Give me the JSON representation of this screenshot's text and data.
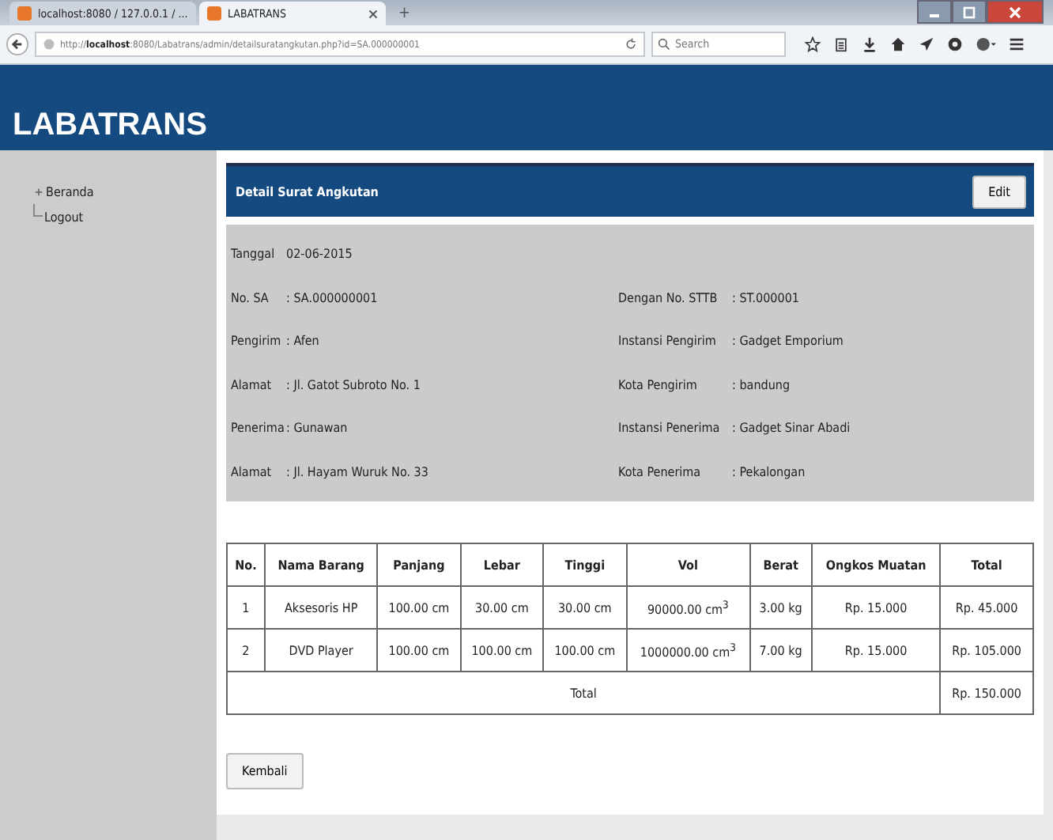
{
  "browser": {
    "tabs": [
      {
        "title": "localhost:8080 / 127.0.0.1 / ...",
        "selected": false
      },
      {
        "title": "LABATRANS",
        "selected": true
      }
    ],
    "new_tab": "+",
    "url_prefix": "http://",
    "url_host": "localhost",
    "url_rest": ":8080/Labatrans/admin/detailsuratangkutan.php?id=SA.000000001",
    "search": {
      "placeholder": "Search"
    }
  },
  "header": {
    "title": "LABATRANS"
  },
  "sidebar": {
    "items": [
      {
        "label": "Beranda",
        "expanded": false
      },
      {
        "label": "Logout"
      }
    ]
  },
  "panel": {
    "title": "Detail Surat Angkutan",
    "edit_button": "Edit"
  },
  "date": {
    "label": "Tanggal",
    "value": "02-06-2015"
  },
  "details": [
    {
      "left": {
        "label": "No. SA",
        "value": ": SA.000000001"
      },
      "right": {
        "label": "Dengan No. STTB",
        "value": ": ST.000001"
      }
    },
    {
      "left": {
        "label": "Pengirim",
        "value": ": Afen"
      },
      "right": {
        "label": "Instansi Pengirim",
        "value": ": Gadget Emporium"
      }
    },
    {
      "left": {
        "label": "Alamat",
        "value": ": Jl. Gatot Subroto No. 1"
      },
      "right": {
        "label": "Kota Pengirim",
        "value": ": bandung"
      }
    },
    {
      "left": {
        "label": "Penerima",
        "value": ": Gunawan"
      },
      "right": {
        "label": "Instansi Penerima",
        "value": ": Gadget Sinar Abadi"
      }
    },
    {
      "left": {
        "label": "Alamat",
        "value": ": Jl. Hayam Wuruk No. 33"
      },
      "right": {
        "label": "Kota Penerima",
        "value": ": Pekalongan"
      }
    }
  ],
  "table": {
    "columns": [
      "No.",
      "Nama Barang",
      "Panjang",
      "Lebar",
      "Tinggi",
      "Vol",
      "Berat",
      "Ongkos Muatan",
      "Total"
    ],
    "rows": [
      [
        "1",
        "Aksesoris HP",
        "100.00 cm",
        "30.00 cm",
        "30.00 cm",
        "90000.00 cm$^{3}$",
        "3.00 kg",
        "Rp. 15.000",
        "Rp. 45.000"
      ],
      [
        "2",
        "DVD Player",
        "100.00 cm",
        "100.00 cm",
        "100.00 cm",
        "1000000.00 cm$^{3}$",
        "7.00 kg",
        "Rp. 15.000",
        "Rp. 105.000"
      ]
    ],
    "total_label": "Total",
    "total_value": "Rp. 150.000"
  },
  "back_button": "Kembali"
}
